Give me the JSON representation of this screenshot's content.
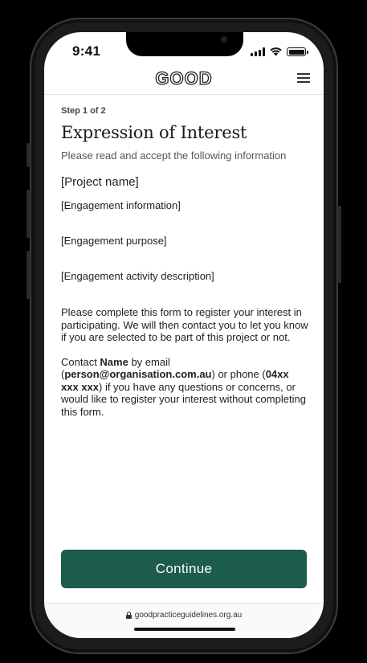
{
  "status_bar": {
    "time": "9:41"
  },
  "header": {
    "logo": "GOOD"
  },
  "form": {
    "step": "Step 1 of 2",
    "title": "Expression of Interest",
    "subtitle": "Please read and accept the following information",
    "project_name": "[Project name]",
    "engagement_information": "[Engagement information]",
    "engagement_purpose": "[Engagement purpose]",
    "engagement_activity": "[Engagement activity description]",
    "paragraph_1": "Please complete this form to register your interest in participating. We will then contact you to let you know if you are selected to be part of this project or not.",
    "contact": {
      "prefix": "Contact ",
      "name": "Name",
      "by_email": " by email (",
      "email": "person@organisation.com.au",
      "or_phone": ") or phone (",
      "phone": "04xx xxx xxx",
      "suffix": ") if you have any questions or concerns, or would like to register your interest without completing this form."
    },
    "continue_label": "Continue"
  },
  "browser": {
    "url": "goodpracticeguidelines.org.au"
  },
  "colors": {
    "button": "#1d5b4c",
    "background": "#ffffff",
    "frame": "#1b1c1e"
  }
}
